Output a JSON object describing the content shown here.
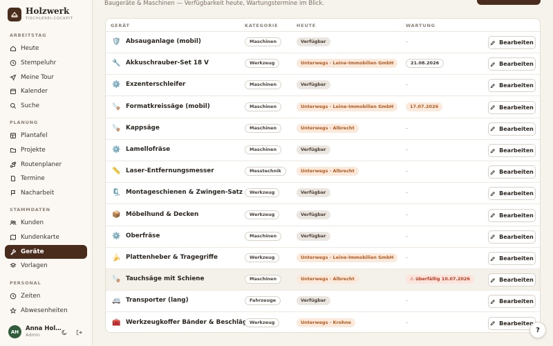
{
  "brand": {
    "name": "Holzwerk",
    "subtitle": "TISCHLEREI-COCKPIT"
  },
  "sidebar": {
    "sections": [
      {
        "label": "ARBEITSTAG",
        "items": [
          {
            "label": "Heute",
            "icon": "home-icon"
          },
          {
            "label": "Stempeluhr",
            "icon": "clock-icon"
          },
          {
            "label": "Meine Tour",
            "icon": "navigation-icon"
          },
          {
            "label": "Kalender",
            "icon": "calendar-icon"
          },
          {
            "label": "Suche",
            "icon": "search-icon"
          }
        ]
      },
      {
        "label": "PLANUNG",
        "items": [
          {
            "label": "Plantafel",
            "icon": "board-icon"
          },
          {
            "label": "Projekte",
            "icon": "folder-icon"
          },
          {
            "label": "Routenplaner",
            "icon": "route-icon"
          },
          {
            "label": "Termine",
            "icon": "document-icon"
          },
          {
            "label": "Nacharbeit",
            "icon": "flag-icon"
          }
        ]
      },
      {
        "label": "STAMMDATEN",
        "items": [
          {
            "label": "Kunden",
            "icon": "users-icon"
          },
          {
            "label": "Kundenkarte",
            "icon": "map-icon"
          },
          {
            "label": "Geräte",
            "icon": "wrench-icon",
            "active": true
          },
          {
            "label": "Vorlagen",
            "icon": "layers-icon"
          }
        ]
      },
      {
        "label": "PERSONAL",
        "items": [
          {
            "label": "Zeiten",
            "icon": "clock-icon"
          },
          {
            "label": "Abwesenheiten",
            "icon": "star-icon"
          }
        ]
      }
    ]
  },
  "user": {
    "initials": "AH",
    "name": "Anna Hol…",
    "role": "Admin"
  },
  "page": {
    "subtitle": "Baugeräte & Maschinen — Verfügbarkeit heute, Wartungstermine im Blick."
  },
  "table": {
    "headers": {
      "name": "GERÄT",
      "category": "KATEGORIE",
      "today": "HEUTE",
      "maintenance": "WARTUNG"
    },
    "edit_label": "Bearbeiten",
    "rows": [
      {
        "icon": "🛡️",
        "name": "Absauganlage (mobil)",
        "category": "Maschinen",
        "status": "Verfügbar",
        "status_type": "ok",
        "maintenance": "–",
        "maintenance_type": "none"
      },
      {
        "icon": "🔧",
        "name": "Akkuschrauber-Set 18 V",
        "category": "Werkzeug",
        "status": "Unterwegs · Leine-Immobilien GmbH",
        "status_type": "out",
        "maintenance": "21.08.2026",
        "maintenance_type": "date"
      },
      {
        "icon": "⚙️",
        "name": "Exzenterschleifer",
        "category": "Maschinen",
        "status": "Verfügbar",
        "status_type": "ok",
        "maintenance": "–",
        "maintenance_type": "none"
      },
      {
        "icon": "🪚",
        "name": "Formatkreissäge (mobil)",
        "category": "Maschinen",
        "status": "Unterwegs · Leine-Immobilien GmbH",
        "status_type": "out",
        "maintenance": "17.07.2026",
        "maintenance_type": "soon"
      },
      {
        "icon": "🪚",
        "name": "Kappsäge",
        "category": "Maschinen",
        "status": "Unterwegs · Albrecht",
        "status_type": "out",
        "maintenance": "–",
        "maintenance_type": "none"
      },
      {
        "icon": "⚙️",
        "name": "Lamellofräse",
        "category": "Maschinen",
        "status": "Verfügbar",
        "status_type": "ok",
        "maintenance": "–",
        "maintenance_type": "none"
      },
      {
        "icon": "📏",
        "name": "Laser-Entfernungsmesser",
        "category": "Messtechnik",
        "status": "Unterwegs · Albrecht",
        "status_type": "out",
        "maintenance": "–",
        "maintenance_type": "none"
      },
      {
        "icon": "🗜️",
        "name": "Montageschienen & Zwingen-Satz",
        "category": "Werkzeug",
        "status": "Verfügbar",
        "status_type": "ok",
        "maintenance": "–",
        "maintenance_type": "none"
      },
      {
        "icon": "📦",
        "name": "Möbelhund & Decken",
        "category": "Werkzeug",
        "status": "Verfügbar",
        "status_type": "ok",
        "maintenance": "–",
        "maintenance_type": "none"
      },
      {
        "icon": "⚙️",
        "name": "Oberfräse",
        "category": "Maschinen",
        "status": "Verfügbar",
        "status_type": "ok",
        "maintenance": "–",
        "maintenance_type": "none"
      },
      {
        "icon": "🍌",
        "name": "Plattenheber & Tragegriffe",
        "category": "Werkzeug",
        "status": "Unterwegs · Leine-Immobilien GmbH",
        "status_type": "out",
        "maintenance": "–",
        "maintenance_type": "none"
      },
      {
        "icon": "🪚",
        "name": "Tauchsäge mit Schiene",
        "category": "Maschinen",
        "status": "Unterwegs · Albrecht",
        "status_type": "out",
        "maintenance": "⚠ überfällig 10.07.2026",
        "maintenance_type": "overdue",
        "highlight": true
      },
      {
        "icon": "🚐",
        "name": "Transporter (lang)",
        "category": "Fahrzeuge",
        "status": "Verfügbar",
        "status_type": "ok",
        "maintenance": "–",
        "maintenance_type": "none"
      },
      {
        "icon": "🧰",
        "name": "Werkzeugkoffer Bänder & Beschläge",
        "category": "Werkzeug",
        "status": "Unterwegs · Krohne",
        "status_type": "out",
        "maintenance": "–",
        "maintenance_type": "none"
      }
    ]
  },
  "help_label": "?"
}
